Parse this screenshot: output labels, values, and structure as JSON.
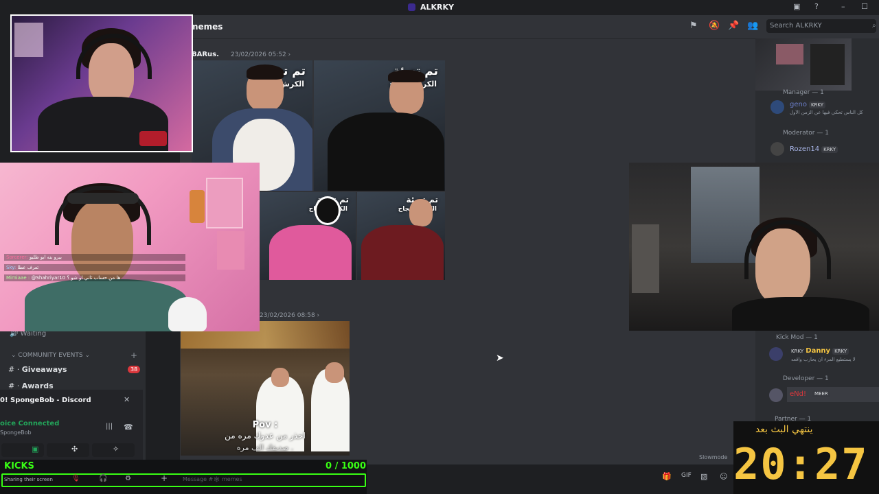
{
  "app": {
    "title": "ALKRKY"
  },
  "channel": {
    "name": "memes",
    "search_placeholder": "Search ALKRKY"
  },
  "messages": [
    {
      "author": "BARus.",
      "timestamp": "23/02/2026 05:52 ›"
    },
    {
      "author": "",
      "timestamp": "23/02/2026 08:58 ›"
    }
  ],
  "meme_tiles": [
    {
      "title": "تم تعبئة",
      "subtitle": "الكرش بنجاح"
    },
    {
      "title": "تم تعبئة",
      "subtitle": "الكرش بنجاح"
    },
    {
      "title": "تم تعبئة",
      "subtitle": "الكرش بنجاح"
    },
    {
      "title": "تم تعبئة",
      "subtitle": "الكرش بنجاح"
    }
  ],
  "video_caption": {
    "line1": "Pov :",
    "line2": "احذر من عدوك مره من",
    "line3": "صديقك الف مره ."
  },
  "stream_chat": [
    {
      "user": "Sorcerer:",
      "text": "بيرو بنه ابو طليو"
    },
    {
      "user": "Sky:",
      "text": "تعرف عطا"
    },
    {
      "user": "Mimiaae :",
      "text": "@Shahriyar10 ها من حساب ثاني او شو ؟"
    }
  ],
  "sidebar": {
    "voice_waiting": "Waiting",
    "category": "COMMUNITY EVENTS",
    "channels": [
      {
        "name": "Giveaways",
        "badge": "38"
      },
      {
        "name": "Awards"
      }
    ],
    "stream_title": "SpongeBob - Discord",
    "voice_status": "oice Connected",
    "voice_sub": "SpongeBob"
  },
  "members": {
    "sections": [
      {
        "label": "Manager — 1",
        "members": [
          {
            "name": "geno",
            "badge": "KRKY",
            "status": "كل الناس تحكي فيها عن الزمن الأول"
          }
        ]
      },
      {
        "label": "Moderator — 1",
        "members": [
          {
            "name": "Rozen14",
            "badge": "KRKY"
          }
        ]
      },
      {
        "label": "Kick Mod — 1",
        "members": [
          {
            "name": "Danny",
            "prefix": "KRKY",
            "badge": "KRKY",
            "status": "لا يستطيع المرء أن يحارب واقعه"
          }
        ]
      },
      {
        "label": "Developer — 1",
        "members": [
          {
            "name": "eNd!",
            "badge": "MEER"
          }
        ]
      },
      {
        "label": "Partner — 1",
        "members": []
      }
    ],
    "slowmode": "Slowmode"
  },
  "overlay": {
    "kicks_label": "KICKS",
    "kicks_count": "0 / 1000",
    "kicks_progress": 0,
    "sharing": "Sharing their screen",
    "input_placeholder": "Message #🕸 memes",
    "timer_label": "ينتهي البث بعد",
    "timer_value": "20:27"
  },
  "colors": {
    "accent_green": "#39ff14",
    "timer_yellow": "#f5c542",
    "badge_red": "#da373c"
  }
}
